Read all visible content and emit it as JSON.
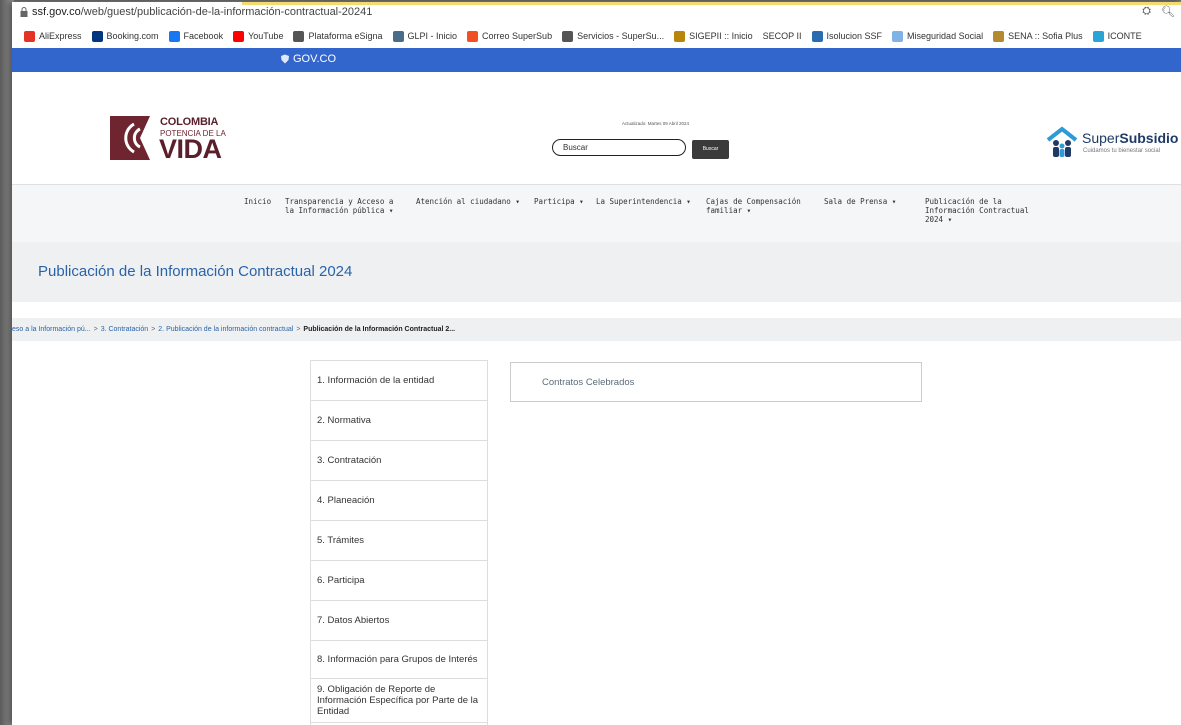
{
  "browser": {
    "url_host": "ssf.gov.co",
    "url_path": "/web/guest/publicación-de-la-información-contractual-20241",
    "bookmarks": [
      "AliExpress",
      "Booking.com",
      "Facebook",
      "YouTube",
      "Plataforma eSigna",
      "GLPI - Inicio",
      "Correo SuperSub",
      "Servicios - SuperSu...",
      "SIGEPII :: Inicio",
      "SECOP II",
      "Isolucion SSF",
      "Miseguridad Social",
      "SENA :: Sofia Plus",
      "ICONTE"
    ],
    "bookmark_icons": [
      "aliexpress-icon",
      "booking-icon",
      "facebook-icon",
      "youtube-icon",
      "globe-icon",
      "glpi-icon",
      "microsoft-icon",
      "globe-icon",
      "sigep-icon",
      "",
      "isolucion-icon",
      "document-icon",
      "sena-icon",
      "iconte-icon"
    ],
    "bookmark_colors": [
      "#e43225",
      "#003580",
      "#1877f2",
      "#ff0000",
      "#555555",
      "#4a6b8a",
      "#f25022",
      "#555555",
      "#b8860b",
      "#ffffff",
      "#2b6cb0",
      "#7fb2e5",
      "#b48a2e",
      "#2aa3d6"
    ]
  },
  "gov_bar": {
    "label": "GOV.CO",
    "color": "#3366cc"
  },
  "header": {
    "brand_line1": "COLOMBIA",
    "brand_line2": "POTENCIA DE LA",
    "brand_line3": "VIDA",
    "updated": "Actualizado: Martes 09 Abril 2024",
    "search_placeholder": "Buscar",
    "search_button": "Buscar",
    "logo_super": "Super",
    "logo_subsidio": "Subsidio",
    "logo_tagline": "Cuidamos tu bienestar social"
  },
  "nav": [
    "Inicio",
    "Transparencia y Acceso a la Información pública ▾",
    "Atención al ciudadano ▾",
    "Participa ▾",
    "La Superintendencia ▾",
    "Cajas de Compensación familiar ▾",
    "Sala de Prensa ▾",
    "Publicación de la Información Contractual 2024 ▾"
  ],
  "page_title": "Publicación de la Información Contractual 2024",
  "breadcrumb": {
    "items": [
      "eso a la Información pú...",
      "3. Contratación",
      "2. Publicación de la información contractual"
    ],
    "current": "Publicación de la Información Contractual 2..."
  },
  "side_menu": [
    "1. Información de la entidad",
    "2. Normativa",
    "3. Contratación",
    "4. Planeación",
    "5. Trámites",
    "6. Participa",
    "7. Datos Abiertos",
    "8. Información para Grupos de Interés",
    "9. Obligación de Reporte de Información Específica por Parte de la Entidad"
  ],
  "content_card": "Contratos Celebrados"
}
